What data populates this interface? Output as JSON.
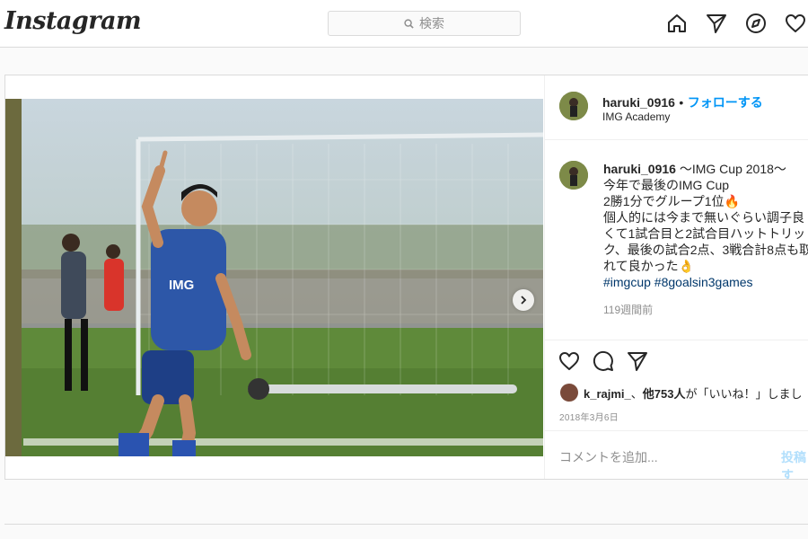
{
  "header": {
    "logo": "Instagram",
    "search_placeholder": "検索",
    "icons": [
      "home-icon",
      "direct-icon",
      "explore-icon",
      "activity-icon"
    ]
  },
  "post": {
    "username": "haruki_0916",
    "separator": "•",
    "follow_label": "フォローする",
    "location": "IMG Academy",
    "caption_title": " 〜IMG Cup 2018〜",
    "caption_lines": [
      "今年で最後のIMG Cup",
      "2勝1分でグループ1位🔥",
      "個人的には今まで無いぐらい調子良",
      "くて1試合目と2試合目ハットトリッ",
      "ク、最後の試合2点、3戦合計8点も取",
      "れて良かった👌"
    ],
    "hashtags": "#imgcup #8goalsin3games",
    "age": "119週間前",
    "likes_user": "k_rajmi_",
    "likes_sep": "、",
    "likes_count": "他753人",
    "likes_suffix": "が「いいね！」しまし",
    "date": "2018年3月6日",
    "comment_placeholder": "コメントを追加...",
    "post_button": "投稿す",
    "carousel_dots": 3,
    "active_dot": 0
  },
  "colors": {
    "accent": "#0095f6",
    "border": "#dbdbdb",
    "muted": "#8e8e8e",
    "hashtag": "#00376b"
  }
}
